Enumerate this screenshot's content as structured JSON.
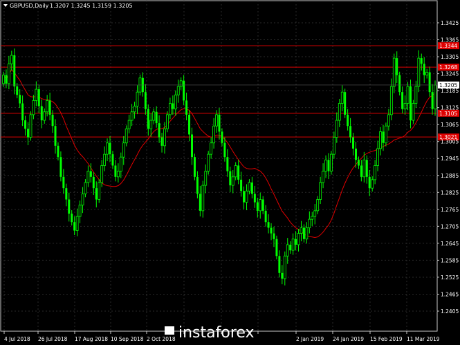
{
  "chart_data": {
    "type": "candlestick",
    "title": "GBPUSD,Daily",
    "ohlc_header": [
      "1.3207",
      "1.3245",
      "1.3159",
      "1.3205"
    ],
    "current_price": "1.3205",
    "ylim": [
      1.2405,
      1.3425
    ],
    "y_ticks": [
      "1.3425",
      "1.3365",
      "1.3305",
      "1.3245",
      "1.3185",
      "1.3125",
      "1.3065",
      "1.3005",
      "1.2945",
      "1.2885",
      "1.2825",
      "1.2765",
      "1.2705",
      "1.2645",
      "1.2585",
      "1.2525",
      "1.2465",
      "1.2405"
    ],
    "x_ticks": [
      "4 Jul 2018",
      "26 Jul 2018",
      "17 Aug 2018",
      "10 Sep 2018",
      "2 Oct 2018",
      "",
      "",
      "",
      "2 Jan 2019",
      "24 Jan 2019",
      "15 Feb 2019",
      "11 Mar 2019"
    ],
    "levels": [
      {
        "label": "1.3344",
        "value": 1.3344
      },
      {
        "label": "1.3268",
        "value": 1.3268
      },
      {
        "label": "1.3105",
        "value": 1.3105
      },
      {
        "label": "1.3021",
        "value": 1.3021
      }
    ],
    "closes": [
      1.324,
      1.321,
      1.328,
      1.331,
      1.32,
      1.317,
      1.314,
      1.308,
      1.305,
      1.302,
      1.31,
      1.315,
      1.319,
      1.313,
      1.308,
      1.311,
      1.315,
      1.31,
      1.306,
      1.299,
      1.295,
      1.288,
      1.284,
      1.28,
      1.275,
      1.272,
      1.269,
      1.274,
      1.278,
      1.282,
      1.286,
      1.29,
      1.288,
      1.284,
      1.28,
      1.286,
      1.292,
      1.296,
      1.3,
      1.296,
      1.292,
      1.288,
      1.29,
      1.295,
      1.3,
      1.305,
      1.308,
      1.311,
      1.313,
      1.318,
      1.323,
      1.318,
      1.312,
      1.305,
      1.308,
      1.311,
      1.307,
      1.302,
      1.299,
      1.305,
      1.31,
      1.314,
      1.312,
      1.317,
      1.32,
      1.322,
      1.315,
      1.31,
      1.303,
      1.295,
      1.288,
      1.282,
      1.276,
      1.285,
      1.29,
      1.296,
      1.3,
      1.306,
      1.31,
      1.304,
      1.3,
      1.295,
      1.29,
      1.285,
      1.288,
      1.292,
      1.287,
      1.283,
      1.279,
      1.283,
      1.286,
      1.282,
      1.279,
      1.276,
      1.28,
      1.276,
      1.272,
      1.27,
      1.268,
      1.266,
      1.26,
      1.254,
      1.252,
      1.26,
      1.264,
      1.262,
      1.266,
      1.264,
      1.268,
      1.27,
      1.266,
      1.27,
      1.273,
      1.274,
      1.276,
      1.28,
      1.286,
      1.29,
      1.294,
      1.29,
      1.296,
      1.302,
      1.308,
      1.314,
      1.318,
      1.31,
      1.306,
      1.302,
      1.298,
      1.294,
      1.292,
      1.288,
      1.294,
      1.288,
      1.284,
      1.287,
      1.292,
      1.298,
      1.304,
      1.3,
      1.306,
      1.31,
      1.32,
      1.33,
      1.324,
      1.318,
      1.312,
      1.314,
      1.32,
      1.308,
      1.314,
      1.32,
      1.33,
      1.328,
      1.324,
      1.325,
      1.318,
      1.312,
      1.3205
    ],
    "ma_color": "#e00000",
    "bull_color": "#00ff00",
    "bear_color": "#00ff00",
    "grid": true,
    "watermark": "instaforex"
  }
}
